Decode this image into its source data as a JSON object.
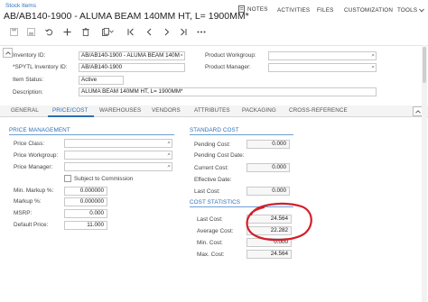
{
  "breadcrumb": "Stock Items",
  "title": "AB/AB140-1900 - ALUMA BEAM 140MM HT, L= 1900MM*",
  "topnav": {
    "notes": "NOTES",
    "activities": "ACTIVITIES",
    "files": "FILES",
    "customization": "CUSTOMIZATION",
    "tools": "TOOLS"
  },
  "toolbar_icons": [
    "save-icon",
    "undo-icon",
    "add-icon",
    "delete-icon",
    "copy-icon",
    "first-icon",
    "previous-icon",
    "next-icon",
    "last-icon",
    "more-icon"
  ],
  "form": {
    "inventory_id_label": "Inventory ID:",
    "inventory_id_value": "AB/AB140-1900 - ALUMA BEAM 140M",
    "spytl_label": "*SPYTL Inventory ID:",
    "spytl_value": "AB/AB140-1900",
    "item_status_label": "Item Status:",
    "item_status_value": "Active",
    "description_label": "Description:",
    "description_value": "ALUMA BEAM 140MM HT, L= 1900MM*",
    "product_workgroup_label": "Product Workgroup:",
    "product_workgroup_value": "",
    "product_manager_label": "Product Manager:",
    "product_manager_value": ""
  },
  "tabs": [
    "GENERAL",
    "PRICE/COST",
    "WAREHOUSES",
    "VENDORS",
    "ATTRIBUTES",
    "PACKAGING",
    "CROSS-REFERENCE"
  ],
  "active_tab": "PRICE/COST",
  "price_management": {
    "title": "PRICE MANAGEMENT",
    "price_class_label": "Price Class:",
    "price_class_value": "",
    "price_workgroup_label": "Price Workgroup:",
    "price_workgroup_value": "",
    "price_manager_label": "Price Manager:",
    "price_manager_value": "",
    "subject_to_commission_label": "Subject to Commission",
    "min_markup_label": "Min. Markup %:",
    "min_markup_value": "0.000000",
    "markup_label": "Markup %:",
    "markup_value": "0.000000",
    "msrp_label": "MSRP:",
    "msrp_value": "0.000",
    "default_price_label": "Default Price:",
    "default_price_value": "11.000"
  },
  "standard_cost": {
    "title": "STANDARD COST",
    "pending_cost_label": "Pending Cost:",
    "pending_cost_value": "0.000",
    "pending_cost_date_label": "Pending Cost Date:",
    "pending_cost_date_value": "",
    "current_cost_label": "Current Cost:",
    "current_cost_value": "0.000",
    "effective_date_label": "Effective Date:",
    "effective_date_value": "",
    "last_cost_label": "Last Cost:",
    "last_cost_value": "0.000"
  },
  "cost_statistics": {
    "title": "COST STATISTICS",
    "last_cost_label": "Last Cost:",
    "last_cost_value": "24.564",
    "average_cost_label": "Average Cost:",
    "average_cost_value": "22.282",
    "min_cost_label": "Min. Cost:",
    "min_cost_value": "0.000",
    "max_cost_label": "Max. Cost:",
    "max_cost_value": "24.564"
  },
  "annotation_color": "#d3202a",
  "accent_color": "#2f6fb5"
}
